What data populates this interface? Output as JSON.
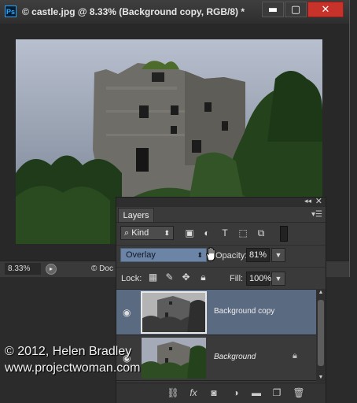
{
  "app": {
    "icon_text": "Ps"
  },
  "document": {
    "title": "© castle.jpg @ 8.33% (Background copy, RGB/8) *",
    "zoom": "8.33%",
    "status_label": "Doc"
  },
  "window_controls": {
    "minimize": "▬",
    "maximize": "▢",
    "close": "✕"
  },
  "layers_panel": {
    "tab": "Layers",
    "filter": {
      "kind": "Kind"
    },
    "blend_mode": "Overlay",
    "opacity_label": "Opacity:",
    "opacity": "81%",
    "lock_label": "Lock:",
    "fill_label": "Fill:",
    "fill": "100%",
    "layers": [
      {
        "name": "Background copy",
        "selected": true,
        "visible": true,
        "locked": false
      },
      {
        "name": "Background",
        "selected": false,
        "visible": true,
        "locked": true
      }
    ],
    "bottom_icons": [
      "link-icon",
      "fx-icon",
      "mask-icon",
      "adjustment-icon",
      "folder-icon",
      "new-layer-icon",
      "trash-icon"
    ]
  },
  "watermark": {
    "line1": "© 2012, Helen Bradley",
    "line2": "www.projectwoman.com"
  },
  "colors": {
    "selected_layer": "#5a6a81",
    "blend_select": "#6c85a6",
    "close_button": "#c7322b",
    "panel_bg": "#3a3a3a"
  }
}
